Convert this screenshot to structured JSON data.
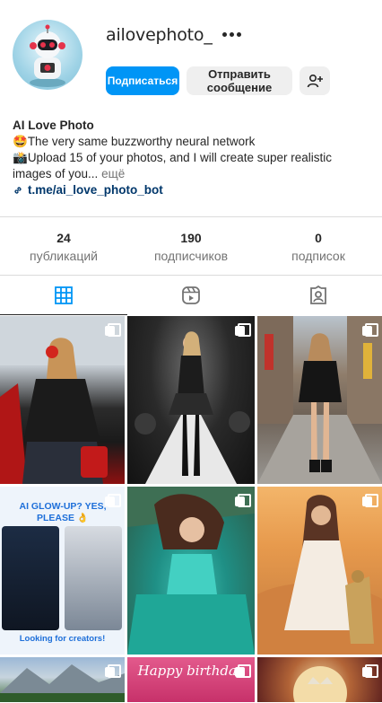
{
  "profile": {
    "username": "ailovephoto_",
    "follow_label": "Подписаться",
    "message_label_line1": "Отправить",
    "message_label_line2": "сообщение"
  },
  "bio": {
    "name": "AI Love Photo",
    "line1_emoji": "🤩",
    "line1": "The very same buzzworthy neural network",
    "line2_emoji": "📸",
    "line2": "Upload 15 of your photos, and I will create super realistic",
    "line3": "images of you...",
    "more": "ещё",
    "link": "t.me/ai_love_photo_bot"
  },
  "stats": [
    {
      "value": "24",
      "label": "публикаций"
    },
    {
      "value": "190",
      "label": "подписчиков"
    },
    {
      "value": "0",
      "label": "подписок"
    }
  ],
  "grid": {
    "post4_title": "AI GLOW-UP? YES, PLEASE 👌",
    "post4_footer": "Looking for creators!",
    "post8_text": "Happy birthday"
  },
  "icons": {
    "more": "more-dots-icon",
    "add_user": "add-user-icon",
    "link": "link-icon",
    "grid_tab": "grid-icon",
    "reels_tab": "reels-icon",
    "tagged_tab": "tagged-icon",
    "multi_post": "carousel-icon"
  },
  "colors": {
    "accent": "#0095f6",
    "link": "#00376b",
    "active_tab_icon": "#0095f6"
  }
}
